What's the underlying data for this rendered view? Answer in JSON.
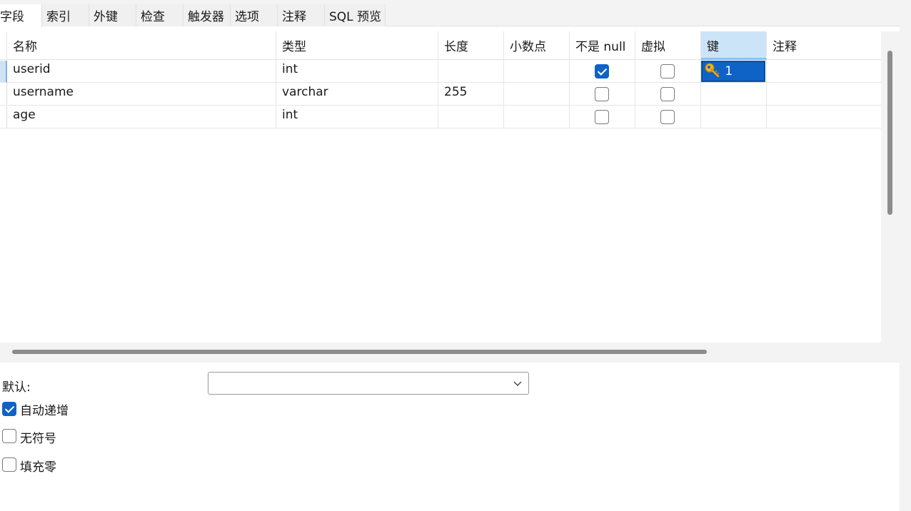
{
  "tabs": [
    {
      "label": "字段",
      "active": true
    },
    {
      "label": "索引",
      "active": false
    },
    {
      "label": "外键",
      "active": false
    },
    {
      "label": "检查",
      "active": false
    },
    {
      "label": "触发器",
      "active": false
    },
    {
      "label": "选项",
      "active": false
    },
    {
      "label": "注释",
      "active": false
    },
    {
      "label": "SQL 预览",
      "active": false
    }
  ],
  "grid": {
    "columns": [
      "名称",
      "类型",
      "长度",
      "小数点",
      "不是 null",
      "虚拟",
      "键",
      "注释"
    ],
    "selected_column": "键",
    "rows": [
      {
        "name": "userid",
        "type": "int",
        "length": "",
        "decimals": "",
        "not_null": true,
        "virtual": false,
        "key": "1",
        "comment": ""
      },
      {
        "name": "username",
        "type": "varchar",
        "length": "255",
        "decimals": "",
        "not_null": false,
        "virtual": false,
        "key": "",
        "comment": ""
      },
      {
        "name": "age",
        "type": "int",
        "length": "",
        "decimals": "",
        "not_null": false,
        "virtual": false,
        "key": "",
        "comment": ""
      }
    ]
  },
  "properties": {
    "default_label": "默认:",
    "default_value": "",
    "auto_increment_label": "自动递增",
    "auto_increment": true,
    "unsigned_label": "无符号",
    "unsigned": false,
    "zerofill_label": "填充零",
    "zerofill": false
  },
  "icons": {
    "key": "key-icon",
    "dropdown": "chevron-down-icon"
  },
  "colors": {
    "accent": "#0f62c6",
    "header_selected": "#cce4f7",
    "row_marker": "#cfe3f5"
  }
}
